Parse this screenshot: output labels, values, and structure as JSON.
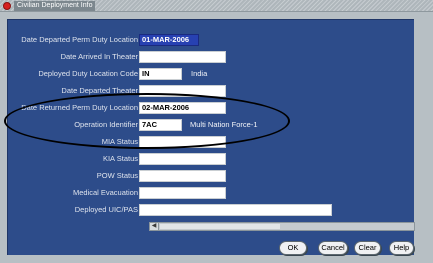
{
  "window": {
    "title": "Civilian Deployment Info"
  },
  "form": {
    "date_departed_perm_duty_location": {
      "label": "Date Departed Perm Duty Location",
      "value": "01-MAR-2006"
    },
    "date_arrived_in_theater": {
      "label": "Date Arrived In Theater",
      "value": ""
    },
    "deployed_duty_location_code": {
      "label": "Deployed Duty Location Code",
      "value": "IN",
      "description": "India"
    },
    "date_departed_theater": {
      "label": "Date Departed Theater",
      "value": ""
    },
    "date_returned_perm_duty_location": {
      "label": "Date Returned Perm Duty Location",
      "value": "02-MAR-2006"
    },
    "operation_identifier": {
      "label": "Operation Identifier",
      "value": "7AC",
      "description": "Multi Nation Force-1"
    },
    "mia_status": {
      "label": "MIA Status",
      "value": ""
    },
    "kia_status": {
      "label": "KIA Status",
      "value": ""
    },
    "pow_status": {
      "label": "POW Status",
      "value": ""
    },
    "medical_evacuation": {
      "label": "Medical Evacuation",
      "value": ""
    },
    "deployed_uic_pas": {
      "label": "Deployed UIC/PAS",
      "value": ""
    }
  },
  "buttons": {
    "ok": "OK",
    "cancel": "Cancel",
    "clear": "Clear",
    "help": "Help"
  },
  "icons": {
    "window": "oracle-window-icon",
    "scroll_left": "scroll-left-arrow-icon"
  },
  "colors": {
    "panel": "#2d4c8a",
    "selected_field": "#2741b2",
    "background": "#b7bfc4"
  }
}
